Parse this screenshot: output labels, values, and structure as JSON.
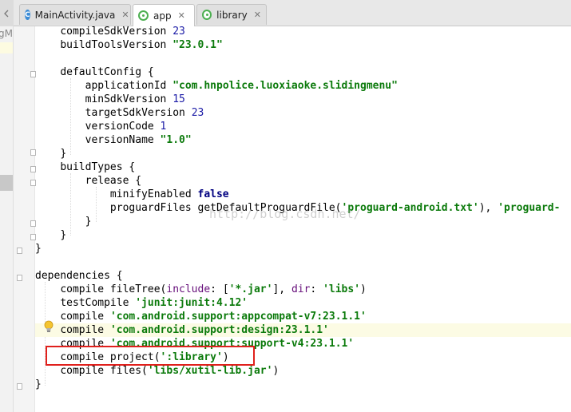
{
  "tabs": [
    {
      "label": "MainActivity.java",
      "icon": "java-class-icon",
      "active": false
    },
    {
      "label": "app",
      "icon": "gradle-module-icon",
      "active": true
    },
    {
      "label": "library",
      "icon": "gradle-module-icon",
      "active": false
    }
  ],
  "left_panel_text": "gM",
  "watermark": "http://blog.csdn.net/",
  "code": {
    "l1": [
      "compileSdkVersion ",
      "23"
    ],
    "l2": [
      "buildToolsVersion ",
      "\"23.0.1\""
    ],
    "l4": [
      "defaultConfig {"
    ],
    "l5": [
      "applicationId ",
      "\"com.hnpolice.luoxiaoke.slidingmenu\""
    ],
    "l6": [
      "minSdkVersion ",
      "15"
    ],
    "l7": [
      "targetSdkVersion ",
      "23"
    ],
    "l8": [
      "versionCode ",
      "1"
    ],
    "l9": [
      "versionName ",
      "\"1.0\""
    ],
    "l10": [
      "}"
    ],
    "l11": [
      "buildTypes {"
    ],
    "l12": [
      "release {"
    ],
    "l13": [
      "minifyEnabled ",
      "false"
    ],
    "l14": [
      "proguardFiles getDefaultProguardFile(",
      "'proguard-android.txt'",
      "), ",
      "'proguard-"
    ],
    "l15": [
      "}"
    ],
    "l16": [
      "}"
    ],
    "l17": [
      "}"
    ],
    "l19": [
      "dependencies {"
    ],
    "l20": [
      "compile fileTree(",
      "include",
      ": [",
      "'*.jar'",
      "], ",
      "dir",
      ": ",
      "'libs'",
      ")"
    ],
    "l21": [
      "testCompile ",
      "'junit:junit:4.12'"
    ],
    "l22": [
      "compile ",
      "'com.android.support:appcompat-v7:23.1.1'"
    ],
    "l23": [
      "compile ",
      "'com.android.support:design:23.1.1'"
    ],
    "l24": [
      "compile ",
      "'com.android.support:support-v4:23.1.1'"
    ],
    "l25": [
      "compile project(",
      "':library'",
      ")"
    ],
    "l26": [
      "compile files(",
      "'libs/xutil-lib.jar'",
      ")"
    ],
    "l27": [
      "}"
    ]
  },
  "colors": {
    "string": "#0b7a0b",
    "number": "#1a1aa6",
    "keyword": "#000080",
    "named_arg": "#660e7a",
    "highlight_box": "#e0201c"
  }
}
